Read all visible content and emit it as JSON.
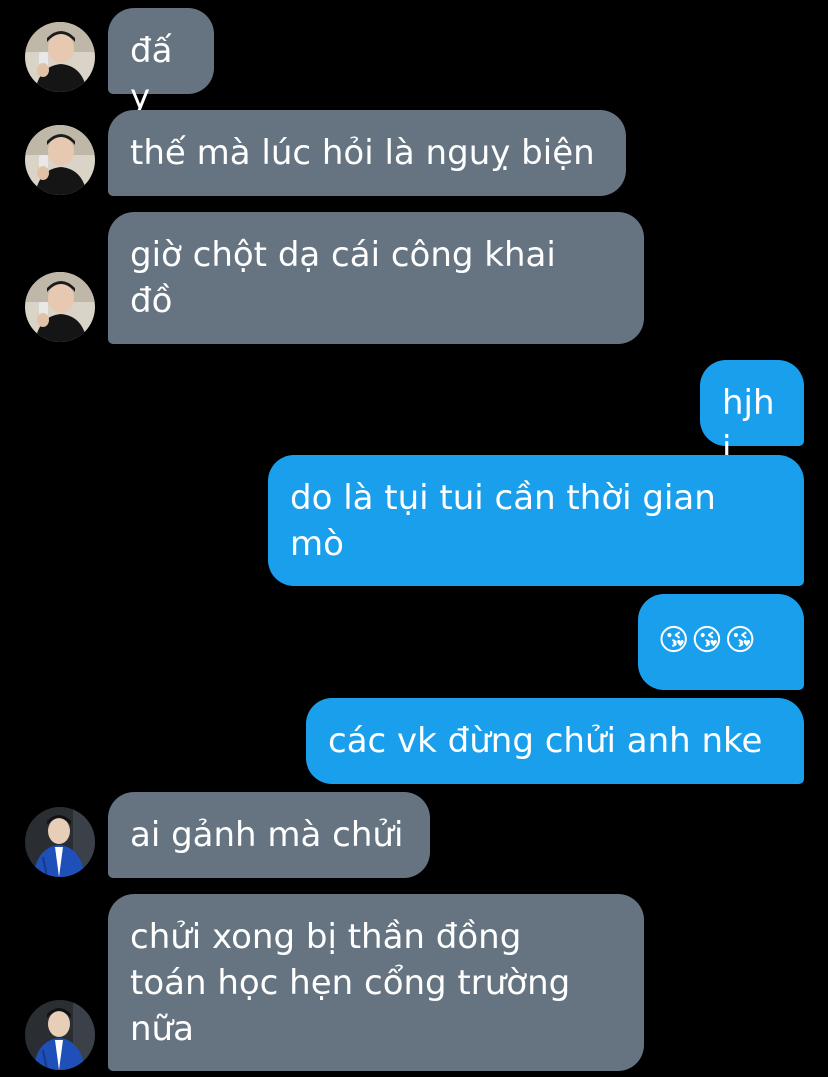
{
  "colors": {
    "background": "#000000",
    "incoming_bubble": "#667482",
    "outgoing_bubble": "#1a9fed",
    "text": "#ffffff"
  },
  "contacts": {
    "user_a_avatar_icon": "person-selfie-avatar-icon",
    "user_b_avatar_icon": "person-blue-jacket-avatar-icon"
  },
  "messages": [
    {
      "direction": "incoming",
      "sender": "user_a",
      "text": "đấy"
    },
    {
      "direction": "incoming",
      "sender": "user_a",
      "text": "thế mà lúc hỏi là nguỵ biện"
    },
    {
      "direction": "incoming",
      "sender": "user_a",
      "text": "giờ chột dạ cái công khai\nđồ"
    },
    {
      "direction": "outgoing",
      "sender": "me",
      "text": "hjhj"
    },
    {
      "direction": "outgoing",
      "sender": "me",
      "text": "do là tụi tui cần thời gian\nmò"
    },
    {
      "direction": "outgoing",
      "sender": "me",
      "text": "😘😘😘"
    },
    {
      "direction": "outgoing",
      "sender": "me",
      "text": "các vk đừng chửi anh nke"
    },
    {
      "direction": "incoming",
      "sender": "user_b",
      "text": "ai gảnh mà chửi"
    },
    {
      "direction": "incoming",
      "sender": "user_b",
      "text": "chửi xong bị thần đồng\ntoán học hẹn cổng trường\nnữa"
    }
  ]
}
